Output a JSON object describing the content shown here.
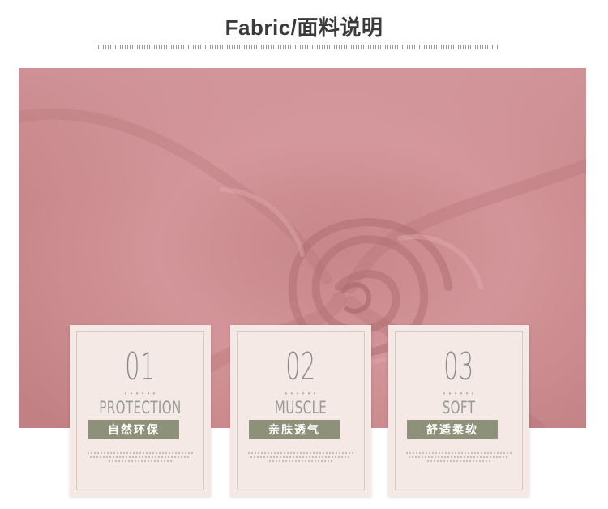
{
  "title": "Fabric/面料说明",
  "colors": {
    "fabric": "#cf8f93",
    "card_bg": "#f4e9e4",
    "badge": "#8d9179"
  },
  "cards": [
    {
      "number": "01",
      "english": "PROTECTION",
      "chinese": "自然环保"
    },
    {
      "number": "02",
      "english": "MUSCLE",
      "chinese": "亲肤透气"
    },
    {
      "number": "03",
      "english": "SOFT",
      "chinese": "舒适柔软"
    }
  ]
}
